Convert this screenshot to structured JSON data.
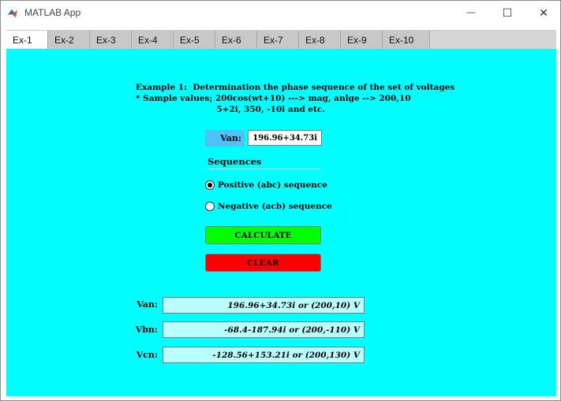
{
  "window": {
    "title": "MATLAB App",
    "minimize_glyph": "—",
    "maximize_glyph": "☐",
    "close_glyph": "✕"
  },
  "tabs": [
    {
      "label": "Ex-1",
      "active": true
    },
    {
      "label": "Ex-2"
    },
    {
      "label": "Ex-3"
    },
    {
      "label": "Ex-4"
    },
    {
      "label": "Ex-5"
    },
    {
      "label": "Ex-6"
    },
    {
      "label": "Ex-7"
    },
    {
      "label": "Ex-8"
    },
    {
      "label": "Ex-9"
    },
    {
      "label": "Ex-10"
    }
  ],
  "main": {
    "description": "Example 1:  Determination the phase sequence of the set of voltages\n* Sample values; 200cos(wt+10) ---> mag, anlge --> 200,10\n                            5+2i, 350, -10i and etc.",
    "van_label": "Van:",
    "van_value": "196.96+34.73i",
    "sequences_title": "Sequences",
    "radio_positive": "Positive (abc) sequence",
    "radio_negative": "Negative (acb) sequence",
    "selected_sequence": "positive",
    "calculate_label": "CALCULATE",
    "clear_label": "CLEAR",
    "outputs": {
      "van_label": "Van:",
      "van_value": "196.96+34.73i or (200,10) V",
      "vbn_label": "Vbn:",
      "vbn_value": "-68.4-187.94i or (200,-110) V",
      "vcn_label": "Vcn:",
      "vcn_value": "-128.56+153.21i or (200,130) V"
    }
  },
  "colors": {
    "panel_bg": "#00ffff",
    "calculate_bg": "#00ff00",
    "clear_bg": "#ff0000",
    "van_label_bg": "#4dc3f5",
    "output_bg": "#b9ffff"
  },
  "icons": {
    "app": "matlab-logo-icon"
  }
}
